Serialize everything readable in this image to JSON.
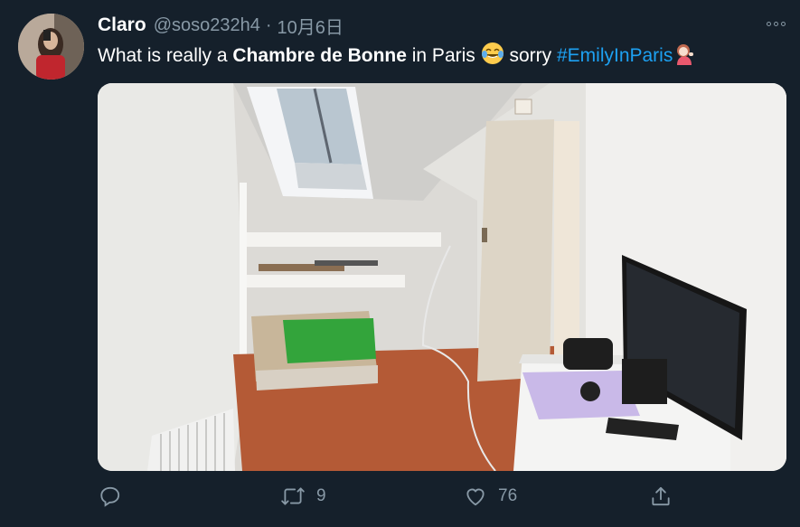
{
  "tweet": {
    "display_name": "Claro",
    "handle": "@soso232h4",
    "separator": "·",
    "date": "10月6日",
    "text_pre": "What is really a ",
    "text_bold": "Chambre de Bonne",
    "text_mid": " in Paris ",
    "text_post": " sorry ",
    "hashtag": "#EmilyInParis",
    "emoji_1": "face-with-tears-of-joy",
    "emoji_2": "person-tipping-hand"
  },
  "actions": {
    "reply_count": "",
    "retweet_count": "9",
    "like_count": "76"
  },
  "colors": {
    "background": "#15202b",
    "secondary_text": "#8899a6",
    "link": "#1da1f2"
  },
  "icons": {
    "more": "more-horizontal-icon",
    "reply": "reply-icon",
    "retweet": "retweet-icon",
    "like": "heart-icon",
    "share": "share-icon"
  }
}
